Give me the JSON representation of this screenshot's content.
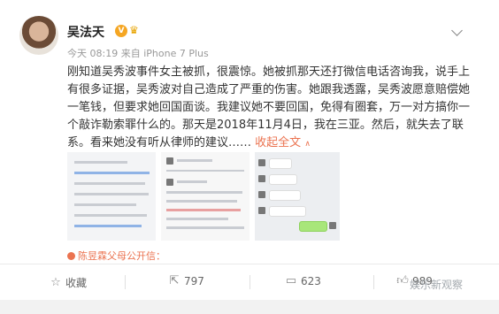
{
  "user": {
    "name": "吴法天",
    "time": "今天 08:19",
    "source_label": "来自",
    "source": "iPhone 7 Plus"
  },
  "post": {
    "text": "刚知道吴秀波事件女主被抓，很震惊。她被抓那天还打微信电话咨询我，说手上有很多证据，吴秀波对自己造成了严重的伤害。她跟我透露，吴秀波愿意赔偿她一笔钱，但要求她回国面谈。我建议她不要回国，免得有圈套，万一对方搞你一个敲诈勒索罪什么的。那天是2018年11月4日，我在三亚。然后，就失去了联系。看来她没有听从律师的建议……",
    "collapse_label": "收起全文",
    "collapse_arrow": "∧"
  },
  "open_letter": "陈昱霖父母公开信：",
  "actions": {
    "favorite": "收藏",
    "repost_count": "797",
    "comment_count": "623",
    "like_count": "989"
  },
  "watermark": "娱乐新观察",
  "colors": {
    "link": "#eb7350",
    "badge": "#f5a623"
  }
}
